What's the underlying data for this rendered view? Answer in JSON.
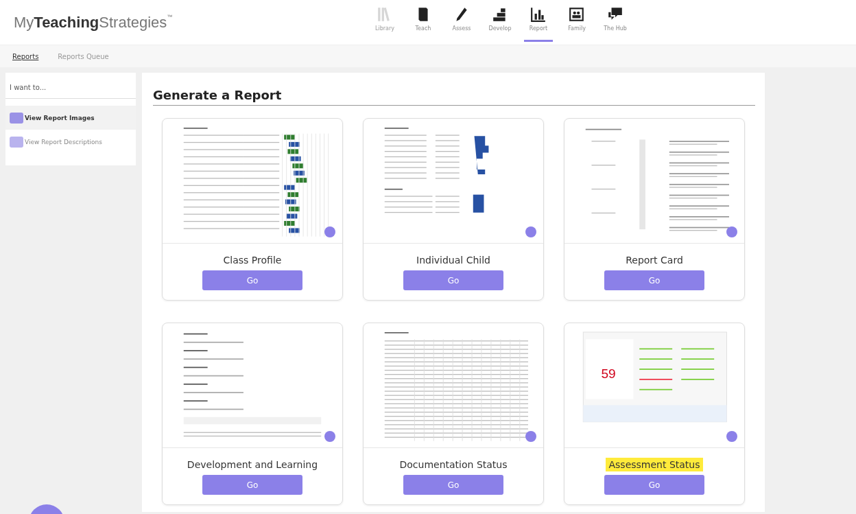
{
  "brand": {
    "prefix": "My",
    "bold": "Teaching",
    "suffix": "Strategies",
    "mark": "™"
  },
  "nav": [
    {
      "label": "Library",
      "kind": "books",
      "selected": false,
      "disabled": true
    },
    {
      "label": "Teach",
      "kind": "book",
      "selected": false,
      "disabled": false
    },
    {
      "label": "Assess",
      "kind": "pencil",
      "selected": false,
      "disabled": false
    },
    {
      "label": "Develop",
      "kind": "steps",
      "selected": false,
      "disabled": false
    },
    {
      "label": "Report",
      "kind": "chart",
      "selected": true,
      "disabled": false
    },
    {
      "label": "Family",
      "kind": "family",
      "selected": false,
      "disabled": false
    },
    {
      "label": "The Hub",
      "kind": "chat",
      "selected": false,
      "disabled": false
    }
  ],
  "subtabs": [
    {
      "label": "Reports",
      "selected": true
    },
    {
      "label": "Reports Queue",
      "selected": false
    }
  ],
  "sidebar": {
    "heading": "I want to...",
    "items": [
      {
        "label": "View Report Images",
        "kind": "images",
        "selected": true
      },
      {
        "label": "View Report Descriptions",
        "kind": "descriptions",
        "selected": false
      }
    ]
  },
  "main": {
    "title": "Generate a Report",
    "cards": [
      {
        "title": "Class Profile",
        "kind": "bars-mixed",
        "button": "Go",
        "highlighted": false
      },
      {
        "title": "Individual Child",
        "kind": "bars-blue",
        "button": "Go",
        "highlighted": false
      },
      {
        "title": "Report Card",
        "kind": "report-card",
        "button": "Go",
        "highlighted": false
      },
      {
        "title": "Development and Learning",
        "kind": "text",
        "button": "Go",
        "highlighted": false
      },
      {
        "title": "Documentation Status",
        "kind": "grid",
        "button": "Go",
        "highlighted": false
      },
      {
        "title": "Assessment Status",
        "kind": "assessment",
        "preview_number": "59",
        "button": "Go",
        "highlighted": true
      }
    ]
  }
}
